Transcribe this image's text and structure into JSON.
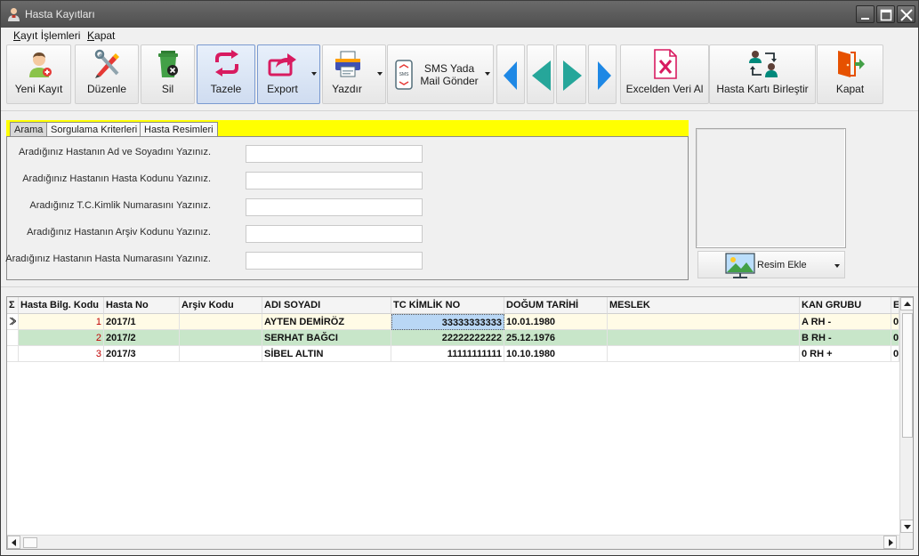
{
  "window": {
    "title": "Hasta Kayıtları"
  },
  "menu": {
    "item1_first": "K",
    "item1_rest": "ayıt İşlemleri",
    "item2_first": "K",
    "item2_rest": "apat"
  },
  "toolbar": {
    "new": "Yeni Kayıt",
    "edit": "Düzenle",
    "delete": "Sil",
    "refresh": "Tazele",
    "export": "Export",
    "print": "Yazdır",
    "sms_line1": "SMS Yada",
    "sms_line2": "Mail Gönder",
    "excel": "Excelden Veri Al",
    "merge": "Hasta Kartı Birleştir",
    "close": "Kapat"
  },
  "tabs": [
    "Arama",
    "Sorgulama Kriterleri",
    "Hasta Resimleri"
  ],
  "search": {
    "labels": [
      "Aradığınız Hastanın Ad ve Soyadını Yazınız.",
      "Aradığınız Hastanın Hasta Kodunu Yazınız.",
      "Aradığınız T.C.Kimlik Numarasını Yazınız.",
      "Aradığınız Hastanın Arşiv Kodunu Yazınız.",
      "Aradığınız Hastanın Hasta Numarasını Yazınız."
    ],
    "values": [
      "",
      "",
      "",
      "",
      ""
    ]
  },
  "image": {
    "add_label": "Resim Ekle"
  },
  "grid": {
    "sigma": "Σ",
    "columns": [
      "Hasta Bilg. Kodu",
      "Hasta No",
      "Arşiv Kodu",
      "ADI SOYADI",
      "TC KİMLİK NO",
      "DOĞUM TARİHİ",
      "MESLEK",
      "KAN GRUBU",
      "E"
    ],
    "rows": [
      {
        "kod": "1",
        "no": "2017/1",
        "arsiv": "",
        "ad": "AYTEN DEMİRÖZ",
        "tc": "33333333333",
        "dogum": "10.01.1980",
        "meslek": "",
        "kan": "A RH -",
        "e": "0"
      },
      {
        "kod": "2",
        "no": "2017/2",
        "arsiv": "",
        "ad": "SERHAT BAĞCI",
        "tc": "22222222222",
        "dogum": "25.12.1976",
        "meslek": "",
        "kan": "B RH -",
        "e": "0"
      },
      {
        "kod": "3",
        "no": "2017/3",
        "arsiv": "",
        "ad": "SİBEL ALTIN",
        "tc": "11111111111",
        "dogum": "10.10.1980",
        "meslek": "",
        "kan": "0 RH +",
        "e": "0"
      }
    ]
  },
  "colors": {
    "tab_strip": "#ffff00",
    "row_current": "#fffbe6",
    "row_alt": "#c8e6c9",
    "selected_cell": "#b9d7f5",
    "accent": "#7a9ad0"
  }
}
